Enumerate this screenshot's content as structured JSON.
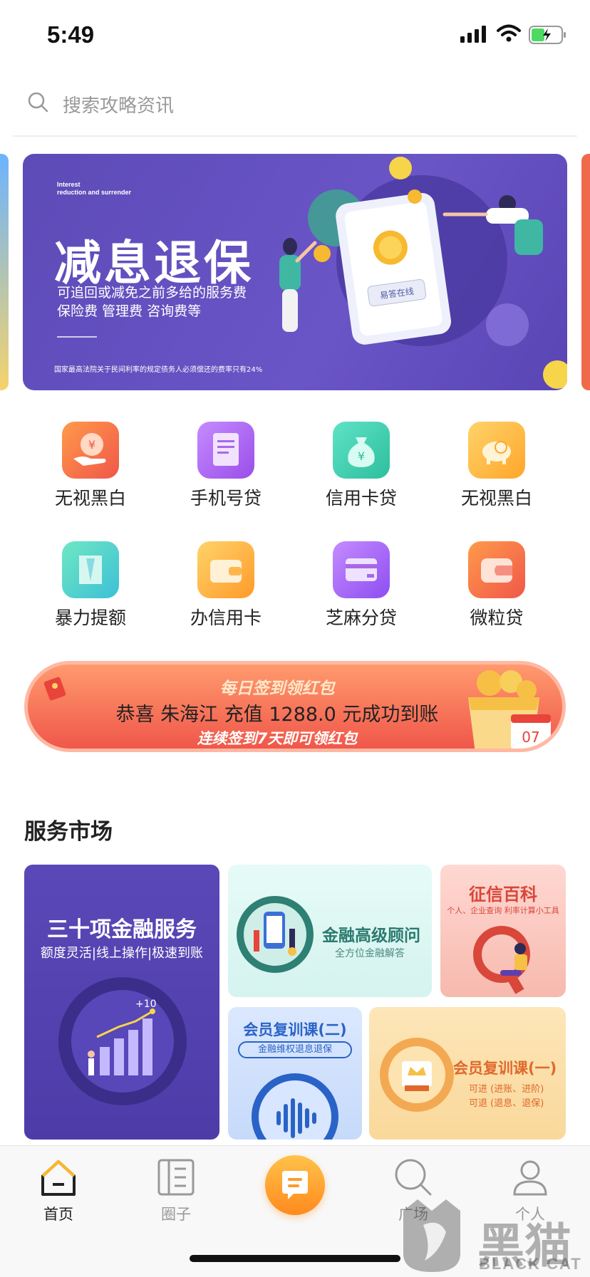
{
  "status_bar": {
    "time": "5:49"
  },
  "search": {
    "placeholder": "搜索攻略资讯"
  },
  "banner": {
    "en_line1": "Interest",
    "en_line2": "reduction and surrender",
    "title": "减息退保",
    "subtitle1": "可追回或减免之前多给的服务费",
    "subtitle2": "保险费  管理费  咨询费等",
    "footnote": "国家最高法院关于民间利率的规定债务人必须偿还的费率只有24%",
    "phone_label": "易答在线"
  },
  "grid": {
    "items": [
      {
        "label": "无视黑白",
        "icon": "yuan-hand-icon"
      },
      {
        "label": "手机号贷",
        "icon": "receipt-icon"
      },
      {
        "label": "信用卡贷",
        "icon": "money-bag-icon"
      },
      {
        "label": "无视黑白",
        "icon": "piggy-bank-icon"
      },
      {
        "label": "暴力提额",
        "icon": "ticket-icon"
      },
      {
        "label": "办信用卡",
        "icon": "wallet-icon"
      },
      {
        "label": "芝麻分贷",
        "icon": "card-icon"
      },
      {
        "label": "微粒贷",
        "icon": "purse-icon"
      }
    ]
  },
  "signin": {
    "title": "每日签到领红包",
    "message": "恭喜 朱海江 充值  1288.0 元成功到账",
    "subtitle": "连续签到7天即可领红包",
    "calendar_day": "07"
  },
  "service_market": {
    "title": "服务市场",
    "cards": {
      "finance": {
        "title": "三十项金融服务",
        "subtitle": "额度灵活|线上操作|极速到账",
        "chart_label": "+10"
      },
      "advisor": {
        "title": "金融高级顾问",
        "subtitle": "全方位金融解答"
      },
      "credit": {
        "title": "征信百科",
        "subtitle": "个人、企业查询  利率计算小工具"
      },
      "course2": {
        "title": "会员复训课(二)",
        "subtitle": "金融维权退息退保"
      },
      "course1": {
        "title": "会员复训课(一)",
        "line1": "可进 (进账、进阶)",
        "line2": "可退 (退息、退保)"
      }
    }
  },
  "tabbar": {
    "home": "首页",
    "circle": "圈子",
    "plaza": "广场",
    "mine": "个人"
  },
  "watermark": {
    "cn": "黑猫",
    "en": "BLACK CAT"
  },
  "colors": {
    "accent": "#ff9a2a",
    "banner_bg": "#5d4bb7",
    "red": "#f0574a"
  }
}
